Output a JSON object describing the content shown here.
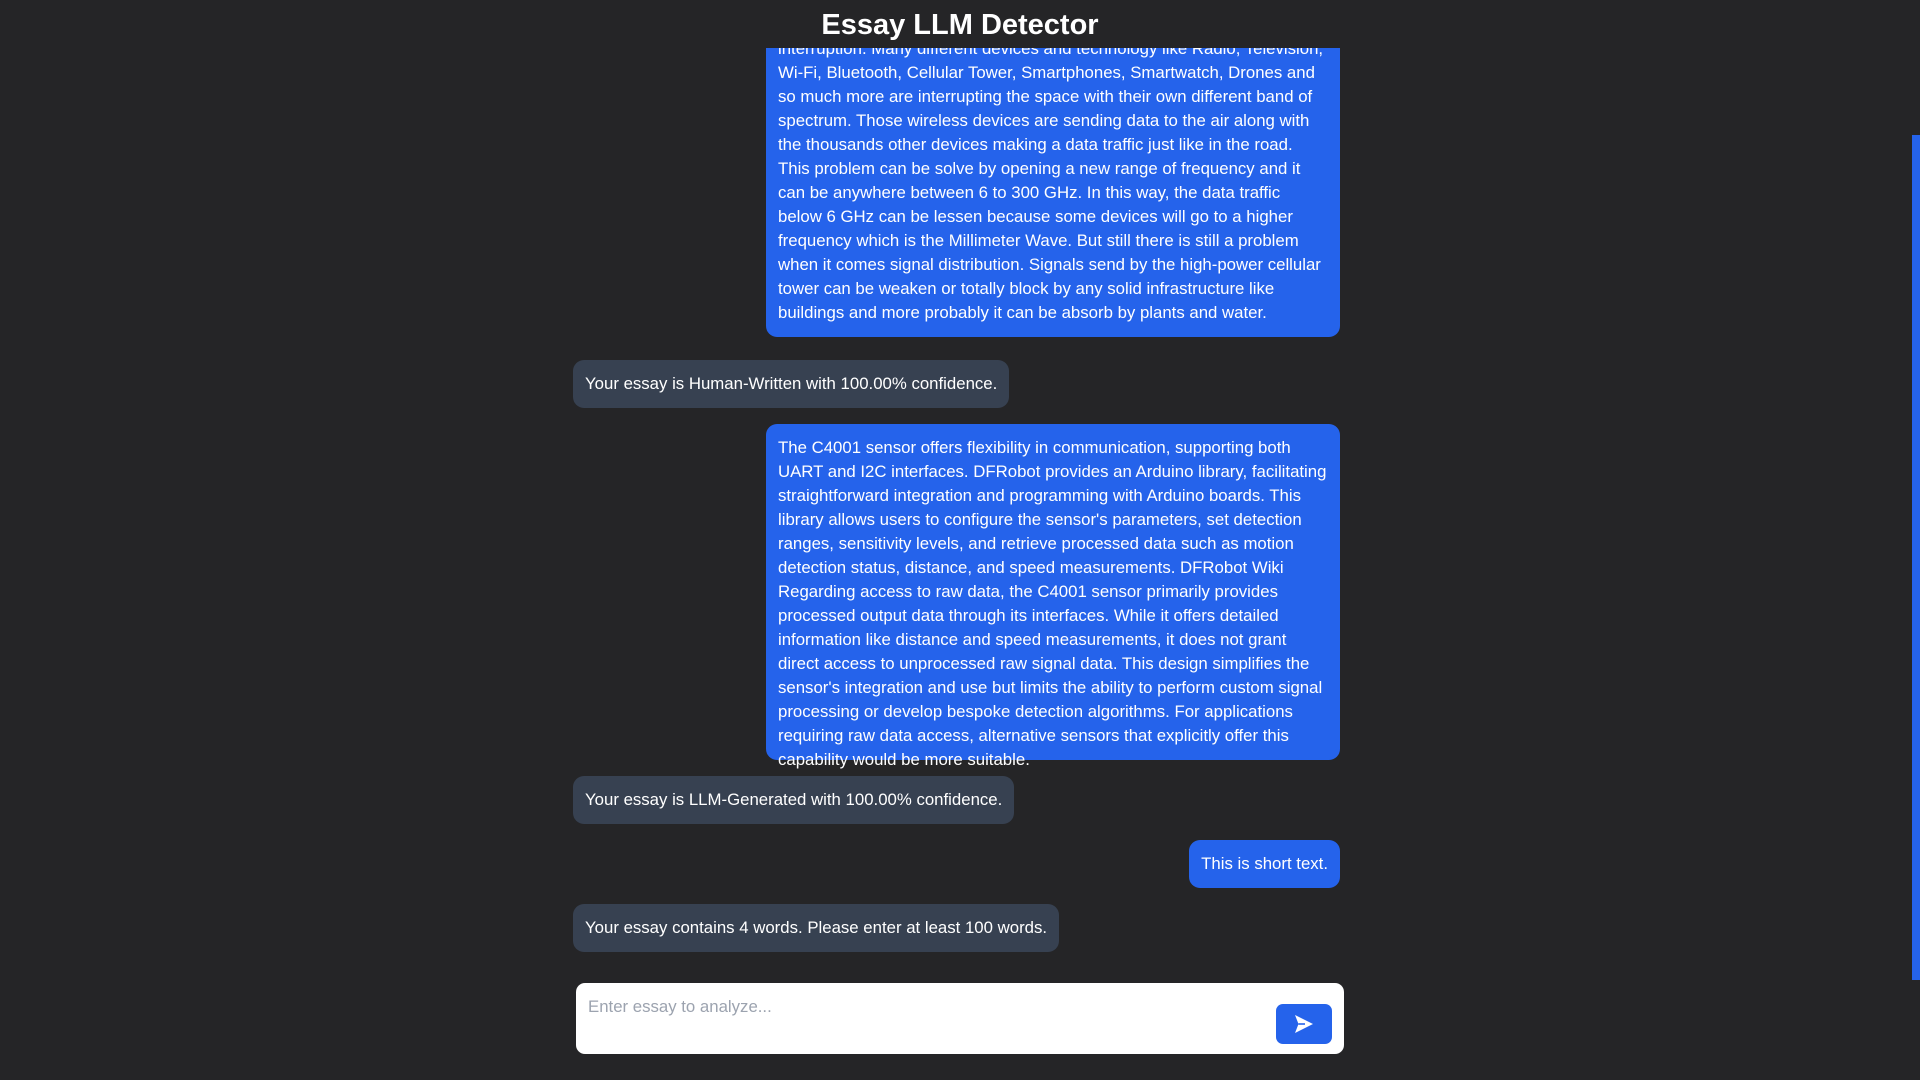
{
  "app": {
    "title": "Essay LLM Detector"
  },
  "messages": [
    {
      "role": "user",
      "text": "interruption. Many different devices and technology like Radio, Television, Wi-Fi, Bluetooth, Cellular Tower, Smartphones, Smartwatch, Drones and so much more are interrupting the space with their own different band of spectrum. Those wireless devices are sending data to the air along with the thousands other devices making a data traffic just like in the road. This problem can be solve by opening a new range of frequency and it can be anywhere between 6 to 300 GHz. In this way, the data traffic below 6 GHz can be lessen because some devices will go to a higher frequency which is the Millimeter Wave. But still there is still a problem when it comes signal distribution. Signals send by the high-power cellular tower can be weaken or totally block by any solid infrastructure like buildings and more probably it can be absorb by plants and water."
    },
    {
      "role": "bot",
      "text": "Your essay is Human-Written with 100.00% confidence."
    },
    {
      "role": "user",
      "text": "The C4001 sensor offers flexibility in communication, supporting both UART and I2C interfaces. DFRobot provides an Arduino library, facilitating straightforward integration and programming with Arduino boards. This library allows users to configure the sensor's parameters, set detection ranges, sensitivity levels, and retrieve processed data such as motion detection status, distance, and speed measurements. DFRobot Wiki Regarding access to raw data, the C4001 sensor primarily provides processed output data through its interfaces. While it offers detailed information like distance and speed measurements, it does not grant direct access to unprocessed raw signal data. This design simplifies the sensor's integration and use but limits the ability to perform custom signal processing or develop bespoke detection algorithms. For applications requiring raw data access, alternative sensors that explicitly offer this capability would be more suitable."
    },
    {
      "role": "bot",
      "text": "Your essay is LLM-Generated with 100.00% confidence."
    },
    {
      "role": "user",
      "text": "This is short text."
    },
    {
      "role": "bot",
      "text": "Your essay contains 4 words. Please enter at least 100 words."
    }
  ],
  "composer": {
    "placeholder": "Enter essay to analyze...",
    "value": ""
  },
  "icons": {
    "send": "send-arrow-icon"
  },
  "colors": {
    "background": "#252527",
    "user_bubble": "#2563eb",
    "bot_bubble": "#374151",
    "accent": "#2563eb"
  }
}
